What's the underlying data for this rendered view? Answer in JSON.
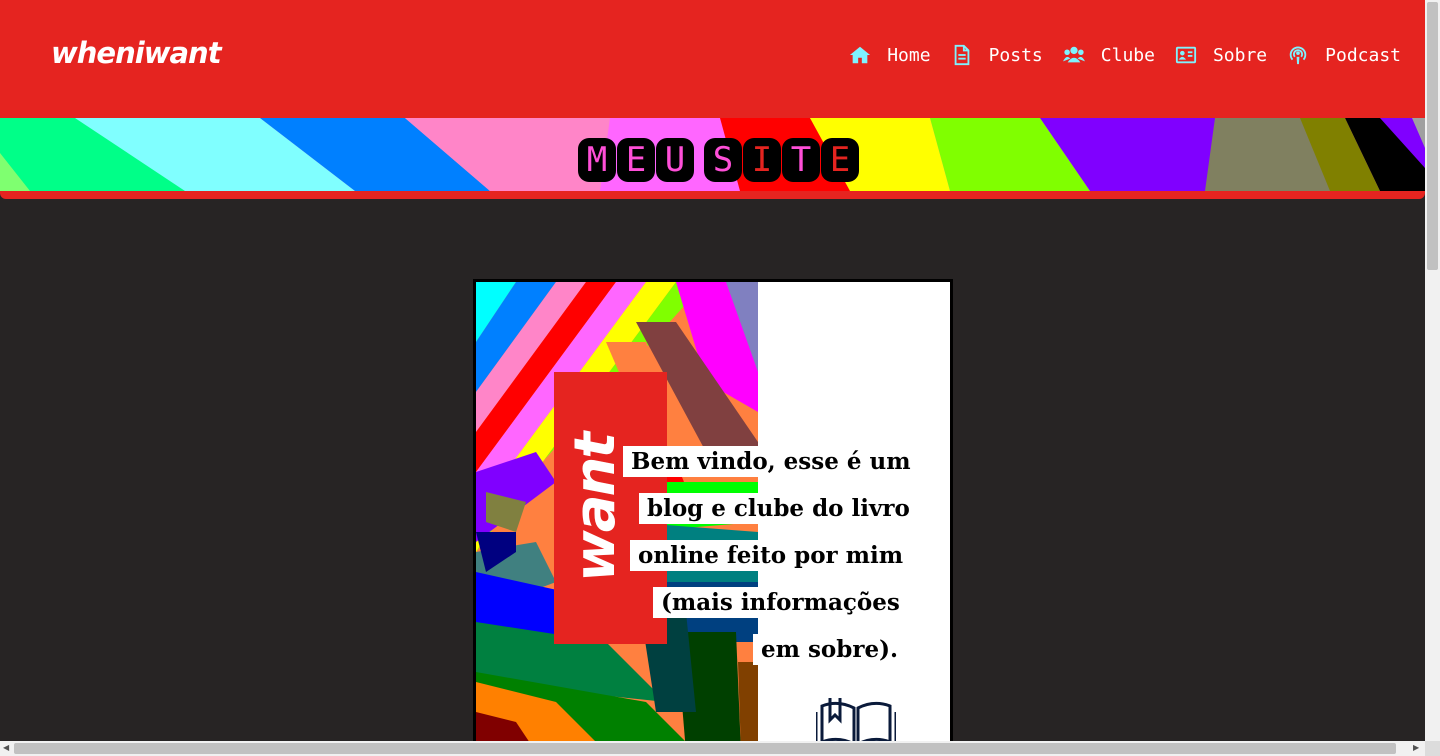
{
  "header": {
    "logo": "wheniwant",
    "bg_color": "#e52420",
    "nav": [
      {
        "label": "Home",
        "icon": "home-icon"
      },
      {
        "label": "Posts",
        "icon": "document-icon"
      },
      {
        "label": "Clube",
        "icon": "users-icon"
      },
      {
        "label": "Sobre",
        "icon": "id-card-icon"
      },
      {
        "label": "Podcast",
        "icon": "podcast-icon"
      }
    ]
  },
  "banner": {
    "title_letters": [
      "M",
      "E",
      "U",
      "",
      "S",
      "I",
      "T",
      "E"
    ],
    "title_colors": [
      "#ff4fd8",
      "#ff4fd8",
      "#ff4fd8",
      "",
      "#ff4fd8",
      "#e52420",
      "#ff4fd8",
      "#e52420"
    ]
  },
  "poster": {
    "brand_word": "want",
    "lines": [
      "Bem vindo, esse é um",
      "blog e clube do livro",
      "online feito por mim",
      "(mais informações",
      "em sobre)."
    ],
    "icon": "open-book-icon"
  },
  "colors": {
    "background": "#272424",
    "accent_red": "#e52420",
    "nav_icon": "#7ff3ff"
  }
}
